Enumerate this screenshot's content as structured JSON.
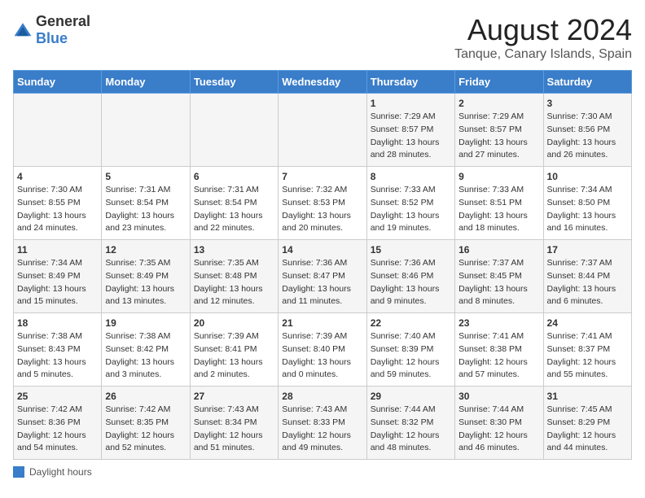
{
  "header": {
    "logo_general": "General",
    "logo_blue": "Blue",
    "title": "August 2024",
    "subtitle": "Tanque, Canary Islands, Spain"
  },
  "days_of_week": [
    "Sunday",
    "Monday",
    "Tuesday",
    "Wednesday",
    "Thursday",
    "Friday",
    "Saturday"
  ],
  "weeks": [
    [
      {
        "day": "",
        "info": ""
      },
      {
        "day": "",
        "info": ""
      },
      {
        "day": "",
        "info": ""
      },
      {
        "day": "",
        "info": ""
      },
      {
        "day": "1",
        "info": "Sunrise: 7:29 AM\nSunset: 8:57 PM\nDaylight: 13 hours\nand 28 minutes."
      },
      {
        "day": "2",
        "info": "Sunrise: 7:29 AM\nSunset: 8:57 PM\nDaylight: 13 hours\nand 27 minutes."
      },
      {
        "day": "3",
        "info": "Sunrise: 7:30 AM\nSunset: 8:56 PM\nDaylight: 13 hours\nand 26 minutes."
      }
    ],
    [
      {
        "day": "4",
        "info": "Sunrise: 7:30 AM\nSunset: 8:55 PM\nDaylight: 13 hours\nand 24 minutes."
      },
      {
        "day": "5",
        "info": "Sunrise: 7:31 AM\nSunset: 8:54 PM\nDaylight: 13 hours\nand 23 minutes."
      },
      {
        "day": "6",
        "info": "Sunrise: 7:31 AM\nSunset: 8:54 PM\nDaylight: 13 hours\nand 22 minutes."
      },
      {
        "day": "7",
        "info": "Sunrise: 7:32 AM\nSunset: 8:53 PM\nDaylight: 13 hours\nand 20 minutes."
      },
      {
        "day": "8",
        "info": "Sunrise: 7:33 AM\nSunset: 8:52 PM\nDaylight: 13 hours\nand 19 minutes."
      },
      {
        "day": "9",
        "info": "Sunrise: 7:33 AM\nSunset: 8:51 PM\nDaylight: 13 hours\nand 18 minutes."
      },
      {
        "day": "10",
        "info": "Sunrise: 7:34 AM\nSunset: 8:50 PM\nDaylight: 13 hours\nand 16 minutes."
      }
    ],
    [
      {
        "day": "11",
        "info": "Sunrise: 7:34 AM\nSunset: 8:49 PM\nDaylight: 13 hours\nand 15 minutes."
      },
      {
        "day": "12",
        "info": "Sunrise: 7:35 AM\nSunset: 8:49 PM\nDaylight: 13 hours\nand 13 minutes."
      },
      {
        "day": "13",
        "info": "Sunrise: 7:35 AM\nSunset: 8:48 PM\nDaylight: 13 hours\nand 12 minutes."
      },
      {
        "day": "14",
        "info": "Sunrise: 7:36 AM\nSunset: 8:47 PM\nDaylight: 13 hours\nand 11 minutes."
      },
      {
        "day": "15",
        "info": "Sunrise: 7:36 AM\nSunset: 8:46 PM\nDaylight: 13 hours\nand 9 minutes."
      },
      {
        "day": "16",
        "info": "Sunrise: 7:37 AM\nSunset: 8:45 PM\nDaylight: 13 hours\nand 8 minutes."
      },
      {
        "day": "17",
        "info": "Sunrise: 7:37 AM\nSunset: 8:44 PM\nDaylight: 13 hours\nand 6 minutes."
      }
    ],
    [
      {
        "day": "18",
        "info": "Sunrise: 7:38 AM\nSunset: 8:43 PM\nDaylight: 13 hours\nand 5 minutes."
      },
      {
        "day": "19",
        "info": "Sunrise: 7:38 AM\nSunset: 8:42 PM\nDaylight: 13 hours\nand 3 minutes."
      },
      {
        "day": "20",
        "info": "Sunrise: 7:39 AM\nSunset: 8:41 PM\nDaylight: 13 hours\nand 2 minutes."
      },
      {
        "day": "21",
        "info": "Sunrise: 7:39 AM\nSunset: 8:40 PM\nDaylight: 13 hours\nand 0 minutes."
      },
      {
        "day": "22",
        "info": "Sunrise: 7:40 AM\nSunset: 8:39 PM\nDaylight: 12 hours\nand 59 minutes."
      },
      {
        "day": "23",
        "info": "Sunrise: 7:41 AM\nSunset: 8:38 PM\nDaylight: 12 hours\nand 57 minutes."
      },
      {
        "day": "24",
        "info": "Sunrise: 7:41 AM\nSunset: 8:37 PM\nDaylight: 12 hours\nand 55 minutes."
      }
    ],
    [
      {
        "day": "25",
        "info": "Sunrise: 7:42 AM\nSunset: 8:36 PM\nDaylight: 12 hours\nand 54 minutes."
      },
      {
        "day": "26",
        "info": "Sunrise: 7:42 AM\nSunset: 8:35 PM\nDaylight: 12 hours\nand 52 minutes."
      },
      {
        "day": "27",
        "info": "Sunrise: 7:43 AM\nSunset: 8:34 PM\nDaylight: 12 hours\nand 51 minutes."
      },
      {
        "day": "28",
        "info": "Sunrise: 7:43 AM\nSunset: 8:33 PM\nDaylight: 12 hours\nand 49 minutes."
      },
      {
        "day": "29",
        "info": "Sunrise: 7:44 AM\nSunset: 8:32 PM\nDaylight: 12 hours\nand 48 minutes."
      },
      {
        "day": "30",
        "info": "Sunrise: 7:44 AM\nSunset: 8:30 PM\nDaylight: 12 hours\nand 46 minutes."
      },
      {
        "day": "31",
        "info": "Sunrise: 7:45 AM\nSunset: 8:29 PM\nDaylight: 12 hours\nand 44 minutes."
      }
    ]
  ],
  "footer": {
    "legend_label": "Daylight hours"
  }
}
